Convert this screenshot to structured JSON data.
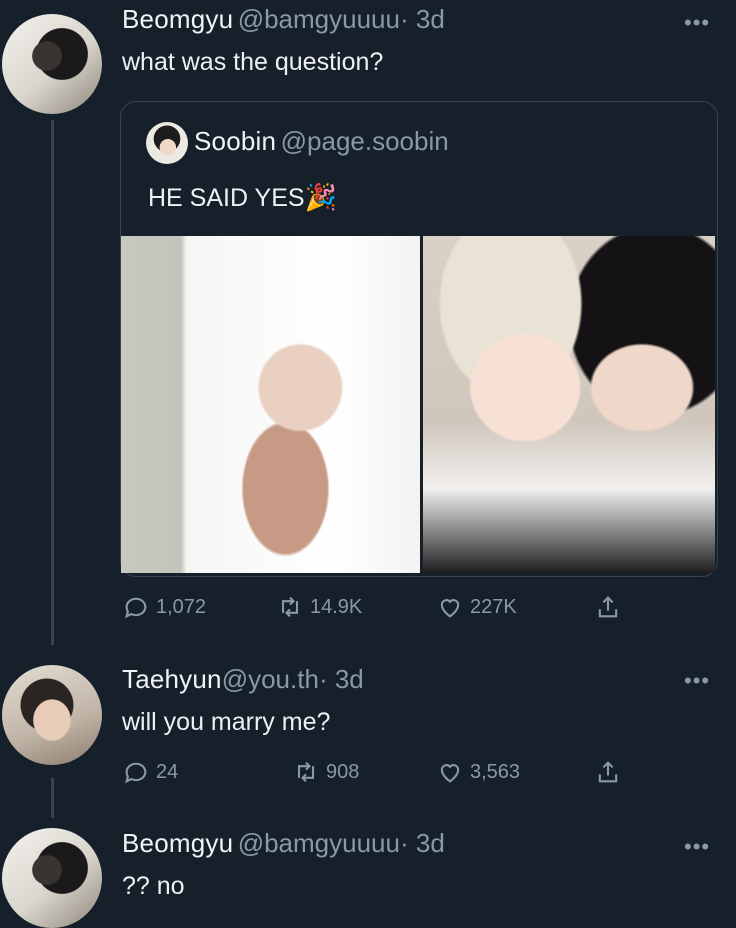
{
  "tweet1": {
    "name": "Beomgyu",
    "handle": "@bamgyuuuu",
    "time": "· 3d",
    "text": "what was the question?",
    "more": "•••",
    "quote": {
      "name": "Soobin",
      "handle": "@page.soobin",
      "text": "HE SAID YES",
      "emoji": "🎉"
    },
    "stats": {
      "replies": "1,072",
      "retweets": "14.9K",
      "likes": "227K"
    }
  },
  "tweet2": {
    "name": "Taehyun",
    "handle": "@you.th",
    "time": "· 3d",
    "text": "will you marry me?",
    "more": "•••",
    "stats": {
      "replies": "24",
      "retweets": "908",
      "likes": "3,563"
    }
  },
  "tweet3": {
    "name": "Beomgyu",
    "handle": "@bamgyuuuu",
    "time": "· 3d",
    "text": "?? no",
    "more": "•••"
  },
  "icons": [
    "reply-icon",
    "retweet-icon",
    "like-icon",
    "share-icon",
    "more-icon"
  ],
  "colors": {
    "background": "#15202b",
    "text": "#e7e9ea",
    "secondary": "#8b98a5",
    "border": "#38444d"
  }
}
